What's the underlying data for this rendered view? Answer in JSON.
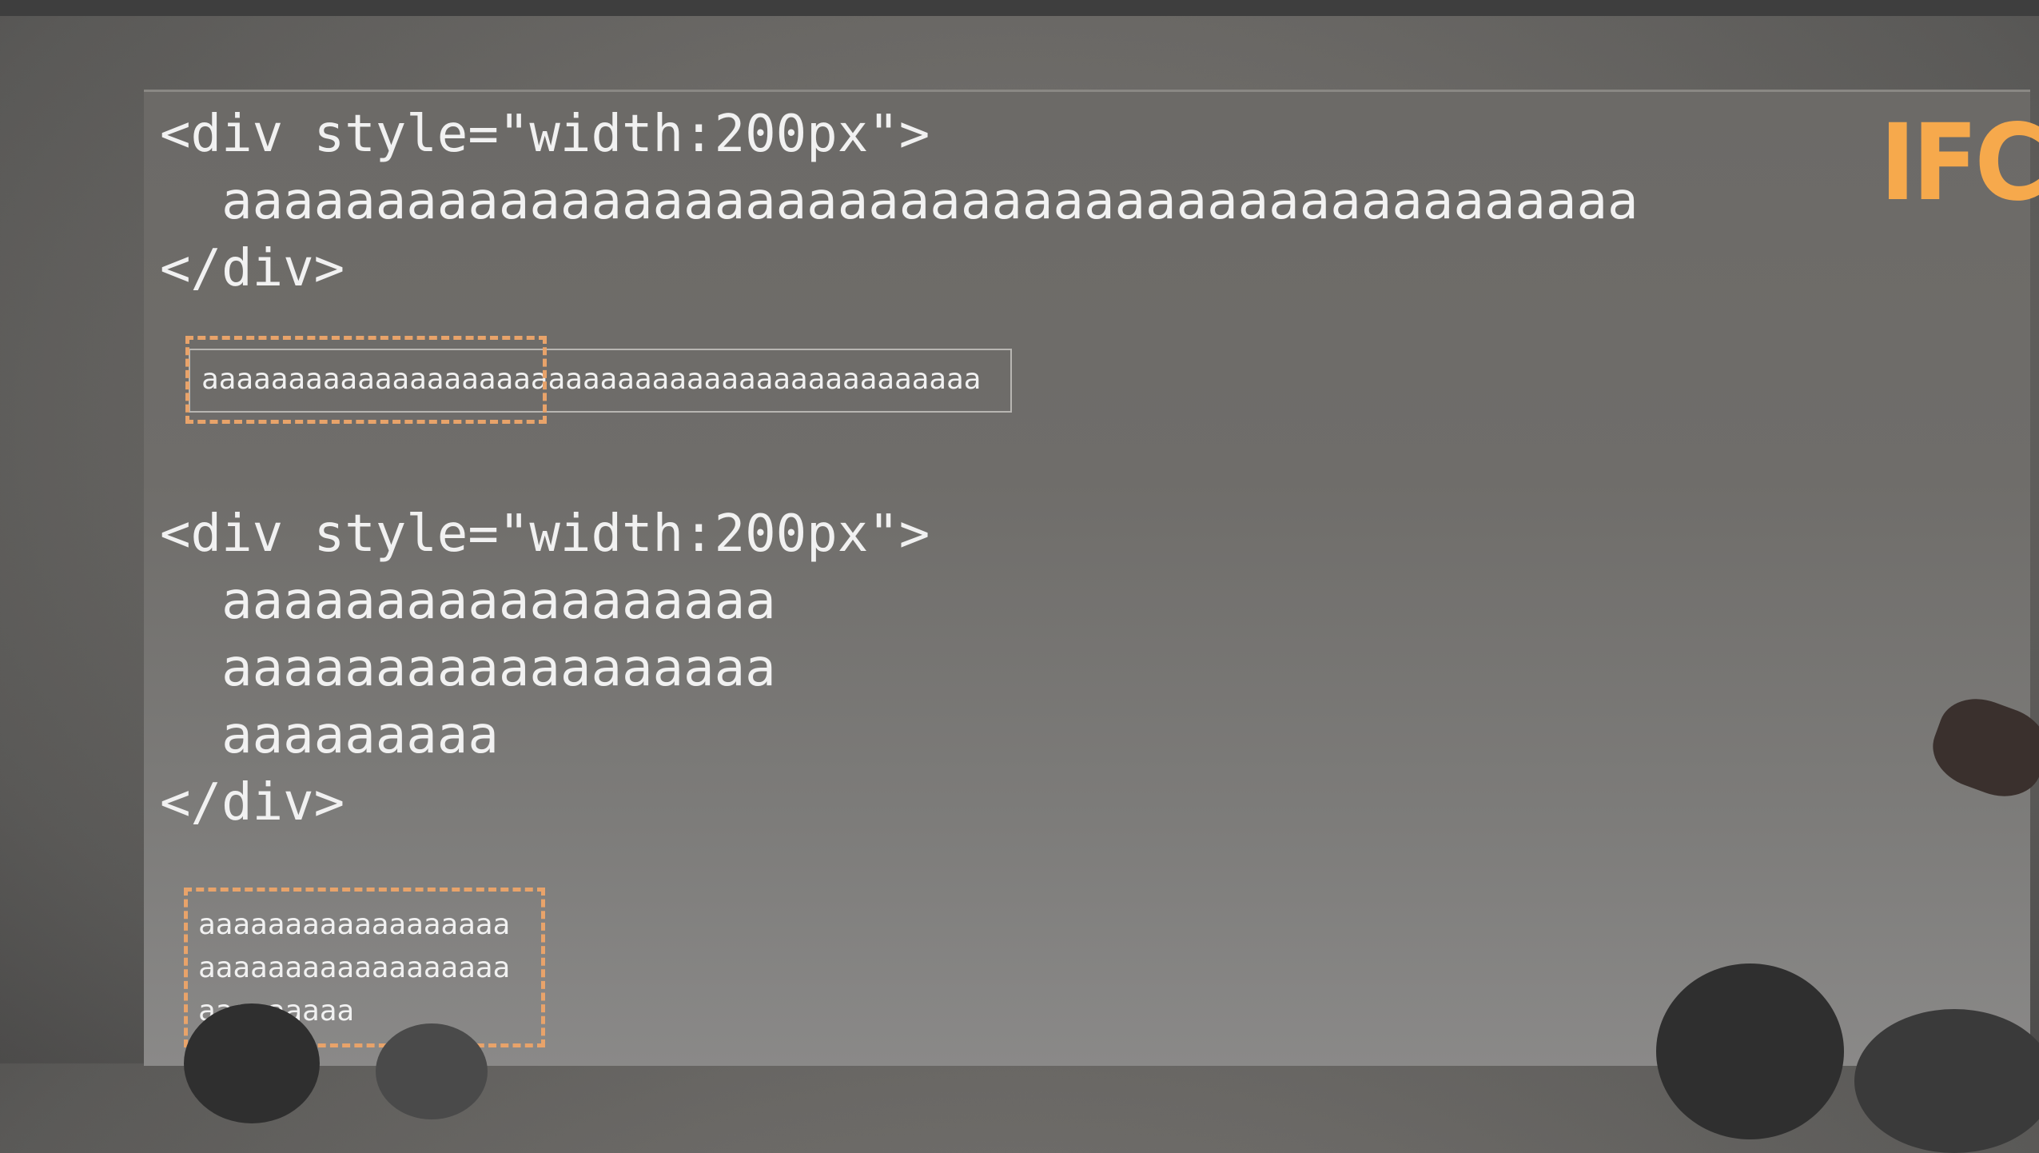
{
  "badge": "IFC",
  "example1": {
    "open_tag": "<div style=\"width:200px\">",
    "text": "  aaaaaaaaaaaaaaaaaaaaaaaaaaaaaaaaaaaaaaaaaaaaaa",
    "close_tag": "</div>",
    "render": "aaaaaaaaaaaaaaaaaaaaaaaaaaaaaaaaaaaaaaaaaaaaa"
  },
  "example2": {
    "open_tag": "<div style=\"width:200px\">",
    "line1": "  aaaaaaaaaaaaaaaaaa",
    "line2": "  aaaaaaaaaaaaaaaaaa",
    "line3": "  aaaaaaaaa",
    "close_tag": "</div>",
    "render_line1": "aaaaaaaaaaaaaaaaaa",
    "render_line2": "aaaaaaaaaaaaaaaaaa",
    "render_line3": "aaaaaaaaa"
  },
  "colors": {
    "accent": "#f6a94c",
    "dashed_border": "#e8a36a",
    "code_text": "#f1f1f1"
  }
}
